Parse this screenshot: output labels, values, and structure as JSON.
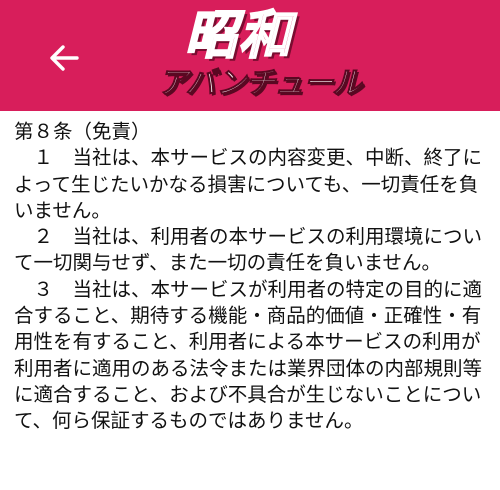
{
  "header": {
    "logo_title": "昭和",
    "logo_subtitle": "アバンチュール",
    "back_icon": "back-arrow-icon",
    "background_color": "#d81e5b"
  },
  "article": {
    "heading": "第８条（免責）",
    "paragraphs": [
      "　１　当社は、本サービスの内容変更、中断、終了によって生じたいかなる損害についても、一切責任を負いません。",
      "　２　当社は、利用者の本サービスの利用環境について一切関与せず、また一切の責任を負いません。",
      "　３　当社は、本サービスが利用者の特定の目的に適合すること、期待する機能・商品的価値・正確性・有用性を有すること、利用者による本サービスの利用が利用者に適用のある法令または業界団体の内部規則等に適合すること、および不具合が生じないことについて、何ら保証するものではありません。"
    ]
  }
}
